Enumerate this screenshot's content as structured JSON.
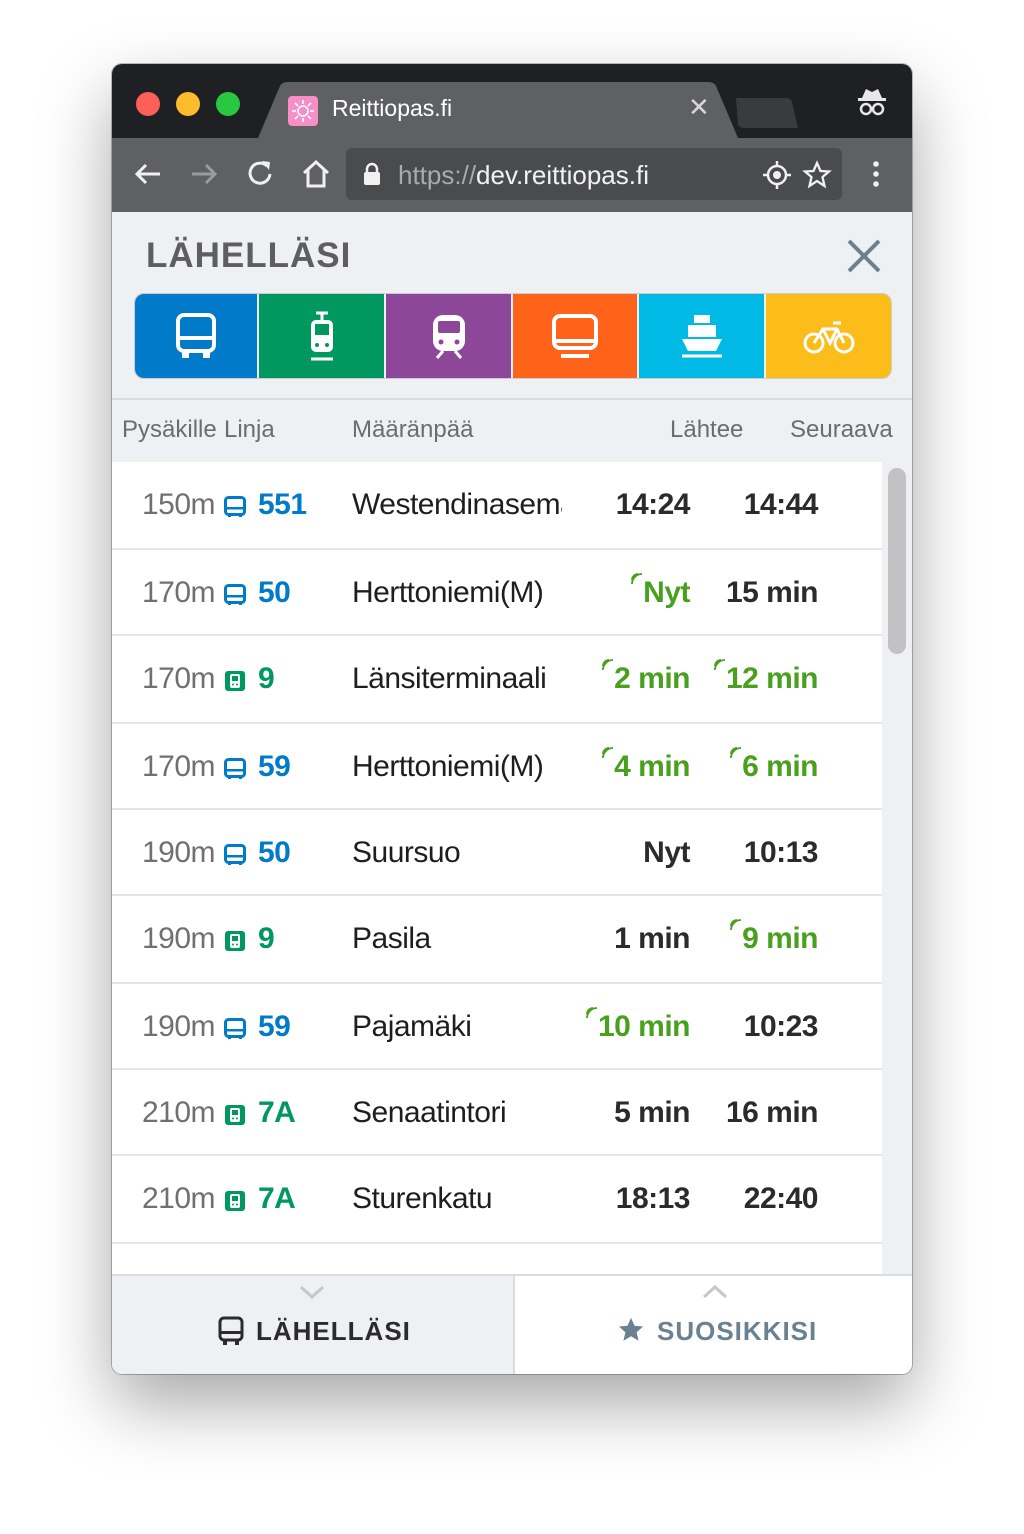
{
  "browser": {
    "tab_title": "Reittiopas.fi",
    "url_scheme": "https://",
    "url_host": "dev.reittiopas.fi"
  },
  "page": {
    "title": "LÄHELLÄSI"
  },
  "modes": [
    {
      "name": "bus",
      "color": "#007ac9"
    },
    {
      "name": "tram",
      "color": "#00985f"
    },
    {
      "name": "rail",
      "color": "#8c4799"
    },
    {
      "name": "subway",
      "color": "#ff6319"
    },
    {
      "name": "ferry",
      "color": "#00b9e4"
    },
    {
      "name": "citybike",
      "color": "#fcbc19"
    }
  ],
  "columns": {
    "stop": "Pysäkille",
    "line": "Linja",
    "destination": "Määränpää",
    "departs": "Lähtee",
    "next": "Seuraava"
  },
  "departures": [
    {
      "dist": "150m",
      "type": "bus",
      "line": "551",
      "dest": "Westendinasema",
      "dep": "14:24",
      "dep_rt": false,
      "next": "14:44",
      "next_rt": false
    },
    {
      "dist": "170m",
      "type": "bus",
      "line": "50",
      "dest": "Herttoniemi(M)",
      "dep": "Nyt",
      "dep_rt": true,
      "next": "15 min",
      "next_rt": false
    },
    {
      "dist": "170m",
      "type": "tram",
      "line": "9",
      "dest": "Länsiterminaali",
      "dep": "2 min",
      "dep_rt": true,
      "next": "12 min",
      "next_rt": true
    },
    {
      "dist": "170m",
      "type": "bus",
      "line": "59",
      "dest": "Herttoniemi(M)",
      "dep": "4 min",
      "dep_rt": true,
      "next": "6 min",
      "next_rt": true
    },
    {
      "dist": "190m",
      "type": "bus",
      "line": "50",
      "dest": "Suursuo",
      "dep": "Nyt",
      "dep_rt": false,
      "next": "10:13",
      "next_rt": false
    },
    {
      "dist": "190m",
      "type": "tram",
      "line": "9",
      "dest": "Pasila",
      "dep": "1 min",
      "dep_rt": false,
      "next": "9 min",
      "next_rt": true
    },
    {
      "dist": "190m",
      "type": "bus",
      "line": "59",
      "dest": "Pajamäki",
      "dep": "10 min",
      "dep_rt": true,
      "next": "10:23",
      "next_rt": false
    },
    {
      "dist": "210m",
      "type": "tram",
      "line": "7A",
      "dest": "Senaatintori",
      "dep": "5 min",
      "dep_rt": false,
      "next": "16 min",
      "next_rt": false
    },
    {
      "dist": "210m",
      "type": "tram",
      "line": "7A",
      "dest": "Sturenkatu",
      "dep": "18:13",
      "dep_rt": false,
      "next": "22:40",
      "next_rt": false
    }
  ],
  "bottom_tabs": {
    "nearby": "LÄHELLÄSI",
    "favourites": "SUOSIKKISI"
  },
  "colors": {
    "bus": "#007ac9",
    "tram": "#00985f",
    "realtime": "#49a01e"
  }
}
